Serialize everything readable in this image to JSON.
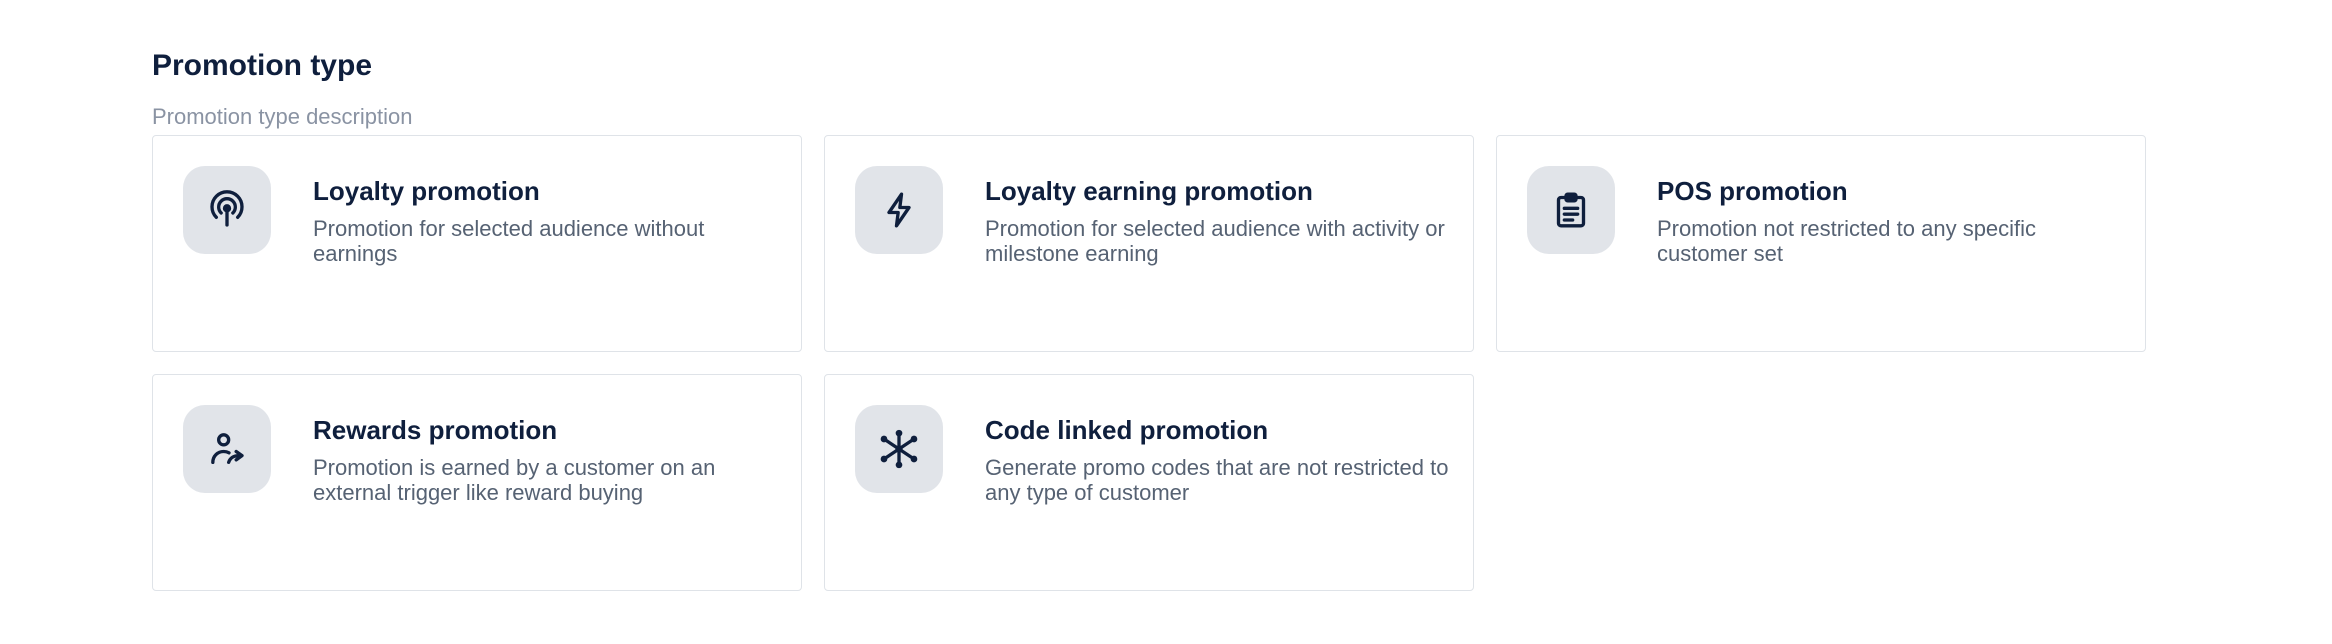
{
  "section": {
    "title": "Promotion type",
    "description": "Promotion type description"
  },
  "promotion_types": [
    {
      "title": "Loyalty promotion",
      "description": "Promotion for selected audience without earnings",
      "icon": "broadcast-icon"
    },
    {
      "title": "Loyalty earning promotion",
      "description": "Promotion for selected audience with activity or milestone earning",
      "icon": "lightning-icon"
    },
    {
      "title": "POS promotion",
      "description": "Promotion not restricted to any specific customer set",
      "icon": "clipboard-icon"
    },
    {
      "title": "Rewards promotion",
      "description": "Promotion is earned by a customer on an external trigger like reward buying",
      "icon": "user-share-icon"
    },
    {
      "title": "Code linked promotion",
      "description": "Generate promo codes that are not restricted to any type of customer",
      "icon": "network-icon"
    }
  ],
  "colors": {
    "title": "#0f1f3d",
    "description": "#566273",
    "subtitle": "#8a93a3",
    "icon_tile_bg": "#e1e4e9",
    "card_border": "#dfe3e8"
  }
}
